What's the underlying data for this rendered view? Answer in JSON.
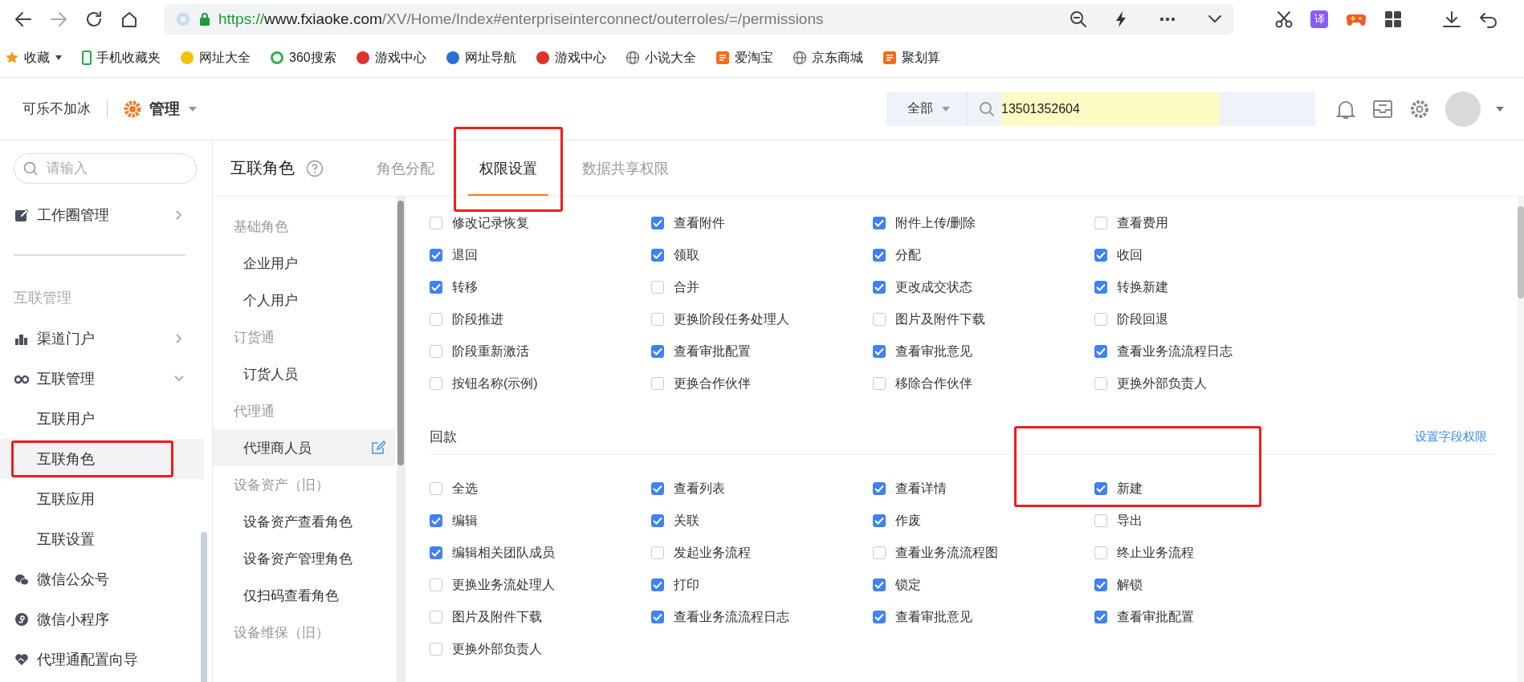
{
  "browser": {
    "url": {
      "scheme": "https://",
      "host": "www.fxiaoke.com",
      "path": "/XV/Home/Index#enterpriseinterconnect/outerroles/=/permissions"
    },
    "translate_label": "译",
    "bookmarks": [
      {
        "kind": "star",
        "label": "收藏"
      },
      {
        "kind": "phone",
        "label": "手机收藏夹"
      },
      {
        "kind": "dot",
        "label": "网址大全",
        "color": "#f2c200"
      },
      {
        "kind": "ring",
        "label": "360搜索",
        "color": "#2fb34a"
      },
      {
        "kind": "dot",
        "label": "游戏中心",
        "color": "#e0322b"
      },
      {
        "kind": "dot",
        "label": "网址导航",
        "color": "#2a6fd6"
      },
      {
        "kind": "dot",
        "label": "游戏中心",
        "color": "#e0322b"
      },
      {
        "kind": "globe",
        "label": "小说大全"
      },
      {
        "kind": "tag",
        "label": "爱淘宝",
        "color": "#f56a1b"
      },
      {
        "kind": "globe",
        "label": "京东商城"
      },
      {
        "kind": "tag",
        "label": "聚划算",
        "color": "#f56a1b"
      }
    ]
  },
  "header": {
    "account": "可乐不加冰",
    "module": "管理",
    "search_scope": "全部",
    "search_value": "13501352604"
  },
  "sidebar": {
    "search_placeholder": "请输入",
    "items": [
      {
        "kind": "item",
        "label": "工作圈管理",
        "expanded": false,
        "selected": false,
        "highlighted": false
      },
      {
        "kind": "divider"
      },
      {
        "kind": "section",
        "label": "互联管理"
      },
      {
        "kind": "item",
        "label": "渠道门户",
        "expanded": false,
        "selected": false,
        "highlighted": false
      },
      {
        "kind": "item",
        "label": "互联管理",
        "expanded": true,
        "selected": false,
        "highlighted": false
      },
      {
        "kind": "sub",
        "label": "互联用户",
        "selected": false,
        "highlighted": false
      },
      {
        "kind": "sub",
        "label": "互联角色",
        "selected": true,
        "highlighted": true
      },
      {
        "kind": "sub",
        "label": "互联应用",
        "selected": false,
        "highlighted": false
      },
      {
        "kind": "sub",
        "label": "互联设置",
        "selected": false,
        "highlighted": false
      },
      {
        "kind": "item",
        "label": "微信公众号",
        "selected": false,
        "highlighted": false
      },
      {
        "kind": "item",
        "label": "微信小程序",
        "selected": false,
        "highlighted": false
      },
      {
        "kind": "item",
        "label": "代理通配置向导",
        "selected": false,
        "highlighted": false
      }
    ]
  },
  "tabs": {
    "title": "互联角色",
    "items": [
      {
        "label": "角色分配",
        "selected": false,
        "highlighted": false
      },
      {
        "label": "权限设置",
        "selected": true,
        "highlighted": true
      },
      {
        "label": "数据共享权限",
        "selected": false,
        "highlighted": false
      }
    ]
  },
  "roles": {
    "groups": [
      {
        "title": "基础角色",
        "items": [
          {
            "label": "企业用户",
            "selected": false
          },
          {
            "label": "个人用户",
            "selected": false
          }
        ]
      },
      {
        "title": "订货通",
        "items": [
          {
            "label": "订货人员",
            "selected": false
          }
        ]
      },
      {
        "title": "代理通",
        "items": [
          {
            "label": "代理商人员",
            "selected": true
          }
        ]
      },
      {
        "title": "设备资产（旧）",
        "items": [
          {
            "label": "设备资产查看角色",
            "selected": false
          },
          {
            "label": "设备资产管理角色",
            "selected": false
          },
          {
            "label": "仅扫码查看角色",
            "selected": false
          }
        ]
      },
      {
        "title": "设备维保（旧）"
      }
    ]
  },
  "permissions": {
    "sections": [
      {
        "items": [
          {
            "label": "修改记录恢复",
            "checked": false,
            "highlighted": false
          },
          {
            "label": "查看附件",
            "checked": true,
            "highlighted": false
          },
          {
            "label": "附件上传/删除",
            "checked": true,
            "highlighted": false
          },
          {
            "label": "查看费用",
            "checked": false,
            "highlighted": false
          },
          {
            "label": "退回",
            "checked": true,
            "highlighted": false
          },
          {
            "label": "领取",
            "checked": true,
            "highlighted": false
          },
          {
            "label": "分配",
            "checked": true,
            "highlighted": false
          },
          {
            "label": "收回",
            "checked": true,
            "highlighted": false
          },
          {
            "label": "转移",
            "checked": true,
            "highlighted": false
          },
          {
            "label": "合并",
            "checked": false,
            "highlighted": false
          },
          {
            "label": "更改成交状态",
            "checked": true,
            "highlighted": false
          },
          {
            "label": "转换新建",
            "checked": true,
            "highlighted": false
          },
          {
            "label": "阶段推进",
            "checked": false,
            "highlighted": false
          },
          {
            "label": "更换阶段任务处理人",
            "checked": false,
            "highlighted": false
          },
          {
            "label": "图片及附件下载",
            "checked": false,
            "highlighted": false
          },
          {
            "label": "阶段回退",
            "checked": false,
            "highlighted": false
          },
          {
            "label": "阶段重新激活",
            "checked": false,
            "highlighted": false
          },
          {
            "label": "查看审批配置",
            "checked": true,
            "highlighted": false
          },
          {
            "label": "查看审批意见",
            "checked": true,
            "highlighted": false
          },
          {
            "label": "查看业务流流程日志",
            "checked": true,
            "highlighted": false
          },
          {
            "label": "按钮名称(示例)",
            "checked": false,
            "highlighted": false
          },
          {
            "label": "更换合作伙伴",
            "checked": false,
            "highlighted": false
          },
          {
            "label": "移除合作伙伴",
            "checked": false,
            "highlighted": false
          },
          {
            "label": "更换外部负责人",
            "checked": false,
            "highlighted": false
          }
        ]
      },
      {
        "title": "回款",
        "link": "设置字段权限",
        "items": [
          {
            "label": "全选",
            "checked": false,
            "highlighted": false
          },
          {
            "label": "查看列表",
            "checked": true,
            "highlighted": false
          },
          {
            "label": "查看详情",
            "checked": true,
            "highlighted": false
          },
          {
            "label": "新建",
            "checked": true,
            "highlighted": true
          },
          {
            "label": "编辑",
            "checked": true,
            "highlighted": false
          },
          {
            "label": "关联",
            "checked": true,
            "highlighted": false
          },
          {
            "label": "作废",
            "checked": true,
            "highlighted": false
          },
          {
            "label": "导出",
            "checked": false,
            "highlighted": false
          },
          {
            "label": "编辑相关团队成员",
            "checked": true,
            "highlighted": false
          },
          {
            "label": "发起业务流程",
            "checked": false,
            "highlighted": false
          },
          {
            "label": "查看业务流流程图",
            "checked": false,
            "highlighted": false
          },
          {
            "label": "终止业务流程",
            "checked": false,
            "highlighted": false
          },
          {
            "label": "更换业务流处理人",
            "checked": false,
            "highlighted": false
          },
          {
            "label": "打印",
            "checked": true,
            "highlighted": false
          },
          {
            "label": "锁定",
            "checked": true,
            "highlighted": false
          },
          {
            "label": "解锁",
            "checked": true,
            "highlighted": false
          },
          {
            "label": "图片及附件下载",
            "checked": false,
            "highlighted": false
          },
          {
            "label": "查看业务流流程日志",
            "checked": true,
            "highlighted": false
          },
          {
            "label": "查看审批意见",
            "checked": true,
            "highlighted": false
          },
          {
            "label": "查看审批配置",
            "checked": true,
            "highlighted": false
          },
          {
            "label": "更换外部负责人",
            "checked": false,
            "highlighted": false
          }
        ]
      }
    ]
  }
}
